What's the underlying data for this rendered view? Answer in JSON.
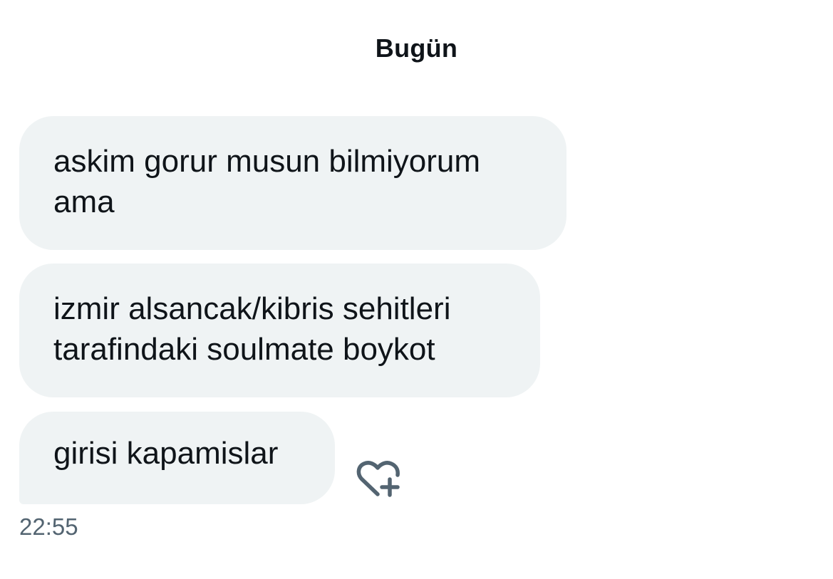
{
  "conversation": {
    "date_label": "Bugün",
    "messages": [
      {
        "line1": "askim gorur musun bilmiyorum",
        "line2": "ama"
      },
      {
        "line1": "izmir alsancak/kibris sehitleri",
        "line2": "tarafindaki soulmate boykot"
      },
      {
        "line1": "girisi kapamislar"
      }
    ],
    "timestamp": "22:55"
  },
  "icons": {
    "react": "heart-plus-icon"
  },
  "colors": {
    "bubble_bg": "#eff3f4",
    "text": "#0f1419",
    "muted": "#536471",
    "background": "#ffffff"
  }
}
